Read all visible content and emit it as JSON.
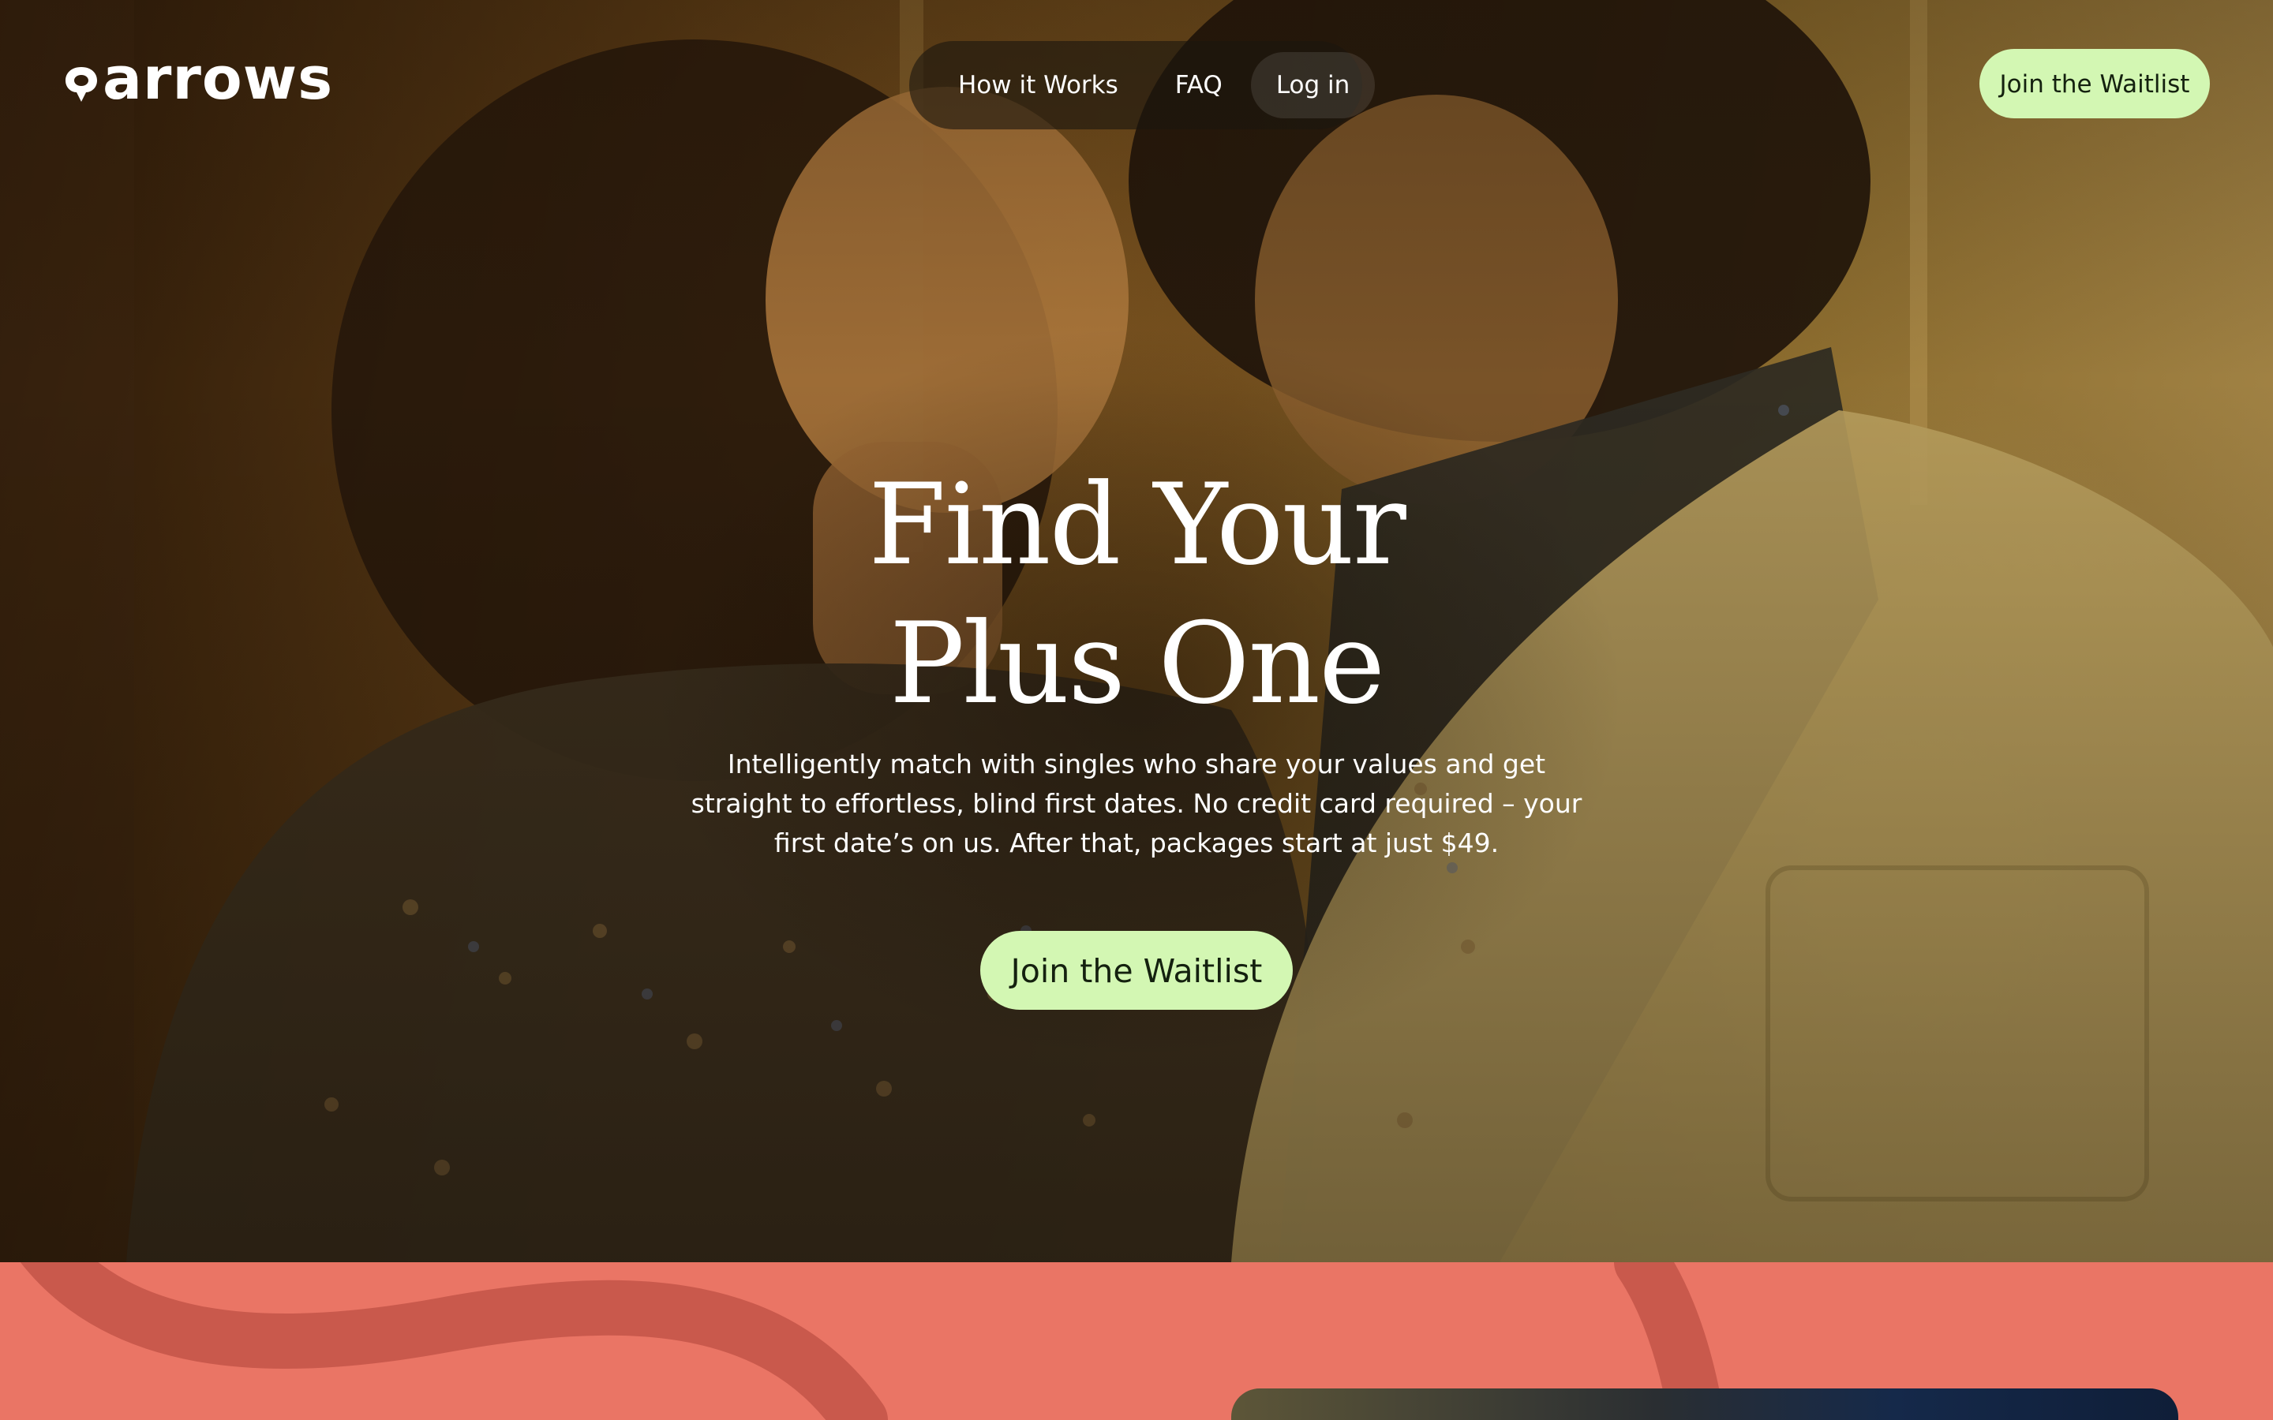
{
  "brand": {
    "name": "arrows",
    "logo_icon": "arrow-heart-icon"
  },
  "nav": {
    "links": [
      {
        "label": "How it Works",
        "active": false
      },
      {
        "label": "FAQ",
        "active": false
      },
      {
        "label": "Log in",
        "active": true
      }
    ],
    "cta_label": "Join the Waitlist"
  },
  "hero": {
    "headline_line1": "Find Your",
    "headline_line2": "Plus One",
    "subtext": "Intelligently match with singles who share your values and get straight to effortless, blind first dates. No credit card required – your first date’s on us. After that, packages start at just $49.",
    "cta_label": "Join the Waitlist",
    "image": "couple-smiling-in-elevator-photo"
  },
  "colors": {
    "accent_green": "#d3f7b3",
    "accent_text": "#14210f",
    "coral": "#ea7565",
    "coral_deco": "#c9594c",
    "nav_pill_bg": "#1c160e"
  }
}
